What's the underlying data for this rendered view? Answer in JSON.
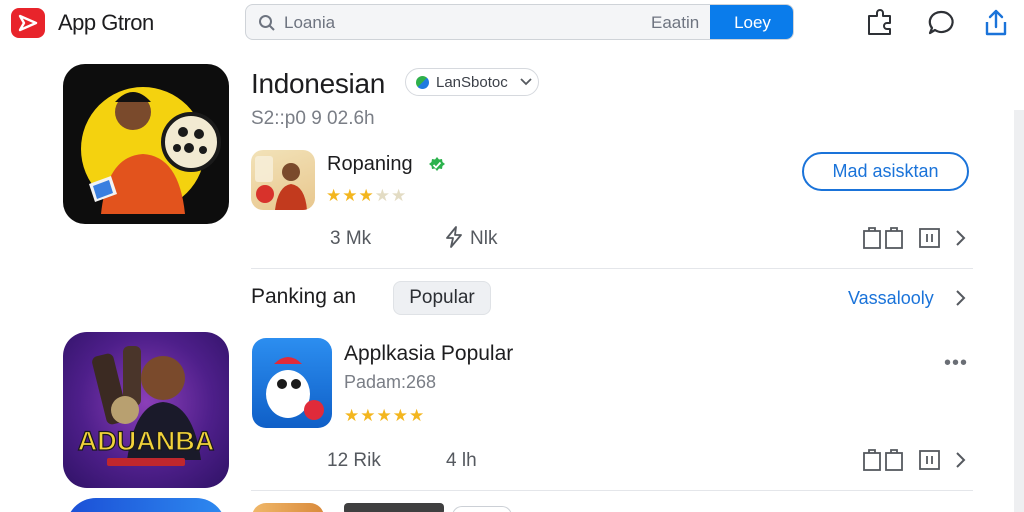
{
  "header": {
    "app_title": "App Gtron",
    "search": {
      "value": "Loania",
      "right_label": "Eaatin",
      "button_label": "Loey"
    }
  },
  "hero": {
    "title": "Indonesian",
    "language": "LanSbotoc",
    "subtitle": "S2::p0 9 02.6h",
    "developer": {
      "name": "Ropaning",
      "rating": 3,
      "rating_max": 5
    },
    "action_button": "Mad asisktan",
    "metrics": {
      "downloads": "3 Mk",
      "size": "Nlk"
    }
  },
  "section": {
    "title": "Panking an",
    "chip": "Popular",
    "see_all": "Vassalooly"
  },
  "app_item": {
    "title": "Applkasia Popular",
    "subtitle": "Padam:268",
    "rating": 5,
    "rating_max": 5,
    "metrics": {
      "downloads": "12 Rik",
      "size": "4 lh"
    },
    "banner_text": "ADUANBA"
  },
  "colors": {
    "accent": "#1a73d9",
    "primary_button": "#0a7ceb",
    "logo": "#e8242b",
    "star": "#f3b61f"
  }
}
